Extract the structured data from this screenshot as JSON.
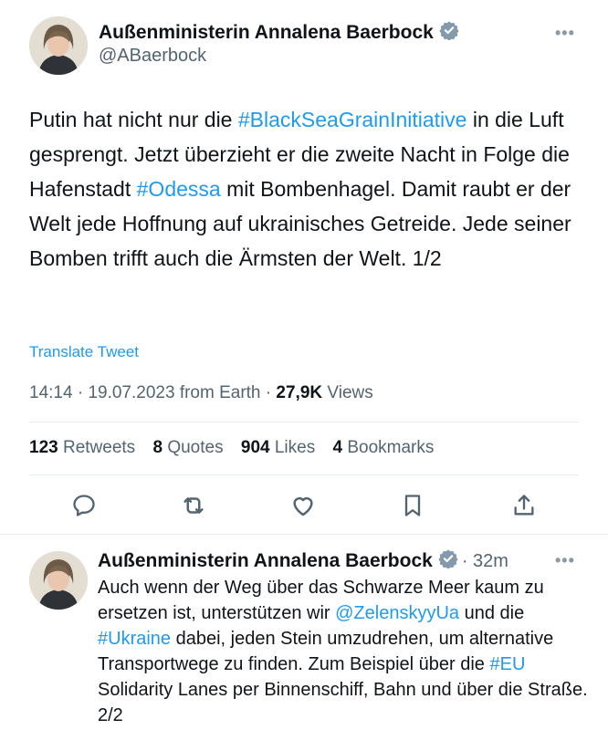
{
  "tweet": {
    "author_name": "Außenministerin Annalena Baerbock",
    "handle": "@ABaerbock",
    "more": "•••",
    "text_parts": [
      "Putin hat nicht nur die ",
      "#BlackSeaGrainInitiative",
      " in die Luft gesprengt. Jetzt überzieht er die zweite Nacht in Folge die Hafenstadt ",
      "#Odessa",
      " mit Bombenhagel. Damit raubt er der Welt jede Hoffnung auf ukrainisches Getreide. Jede seiner Bomben trifft auch die Ärmsten der Welt. 1/2"
    ],
    "translate_label": "Translate Tweet",
    "meta": {
      "time": "14:14",
      "date": "19.07.2023",
      "source": "from Earth",
      "views_count": "27,9K",
      "views_label": "Views",
      "dot": "·"
    },
    "stats": {
      "retweets_count": "123",
      "retweets_label": "Retweets",
      "quotes_count": "8",
      "quotes_label": "Quotes",
      "likes_count": "904",
      "likes_label": "Likes",
      "bookmarks_count": "4",
      "bookmarks_label": "Bookmarks"
    },
    "actions": [
      "reply-icon",
      "retweet-icon",
      "like-icon",
      "bookmark-icon",
      "share-icon"
    ]
  },
  "reply": {
    "author_name": "Außenministerin Annalena Baerbock",
    "time": "· 32m",
    "more": "•••",
    "text_parts": [
      "Auch wenn der Weg über das Schwarze Meer kaum zu ersetzen ist, unterstützen wir ",
      "@ZelenskyyUa",
      " und die ",
      "#Ukraine",
      " dabei, jeden Stein umzudrehen, um alternative Transportwege zu finden. Zum Beispiel über die ",
      "#EU",
      " Solidarity Lanes per Binnenschiff, Bahn und über die Straße. 2/2"
    ]
  },
  "colors": {
    "link": "#1d9bf0",
    "secondary": "#536471",
    "text": "#0f1419",
    "verified": "#829aab"
  }
}
